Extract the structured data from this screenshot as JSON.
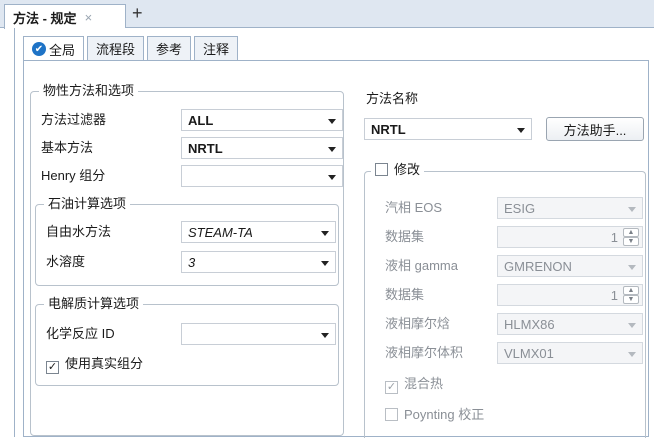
{
  "doc_tab": {
    "title": "方法 - 规定",
    "close": "×",
    "add": "+"
  },
  "sub_tabs": [
    "全局",
    "流程段",
    "参考",
    "注释"
  ],
  "property_methods": {
    "legend": "物性方法和选项",
    "filter_label": "方法过滤器",
    "filter_value": "ALL",
    "base_label": "基本方法",
    "base_value": "NRTL",
    "henry_label": "Henry 组分",
    "henry_value": ""
  },
  "petroleum": {
    "legend": "石油计算选项",
    "free_water_label": "自由水方法",
    "free_water_value": "STEAM-TA",
    "water_sol_label": "水溶度",
    "water_sol_value": "3"
  },
  "electrolyte": {
    "legend": "电解质计算选项",
    "chem_label": "化学反应 ID",
    "chem_value": "",
    "true_comp_label": "使用真实组分",
    "true_comp_checked": true
  },
  "method_name": {
    "heading": "方法名称",
    "value": "NRTL",
    "assistant_button": "方法助手..."
  },
  "modify": {
    "label": "修改",
    "checked": false,
    "rows": [
      {
        "label": "汽相 EOS",
        "value": "ESIG"
      },
      {
        "label": "数据集",
        "value": "1"
      },
      {
        "label": "液相 gamma",
        "value": "GMRENON"
      },
      {
        "label": "数据集",
        "value": "1"
      },
      {
        "label": "液相摩尔焓",
        "value": "HLMX86"
      },
      {
        "label": "液相摩尔体积",
        "value": "VLMX01"
      }
    ],
    "heat_of_mixing": "混合热",
    "poynting": "Poynting 校正"
  }
}
